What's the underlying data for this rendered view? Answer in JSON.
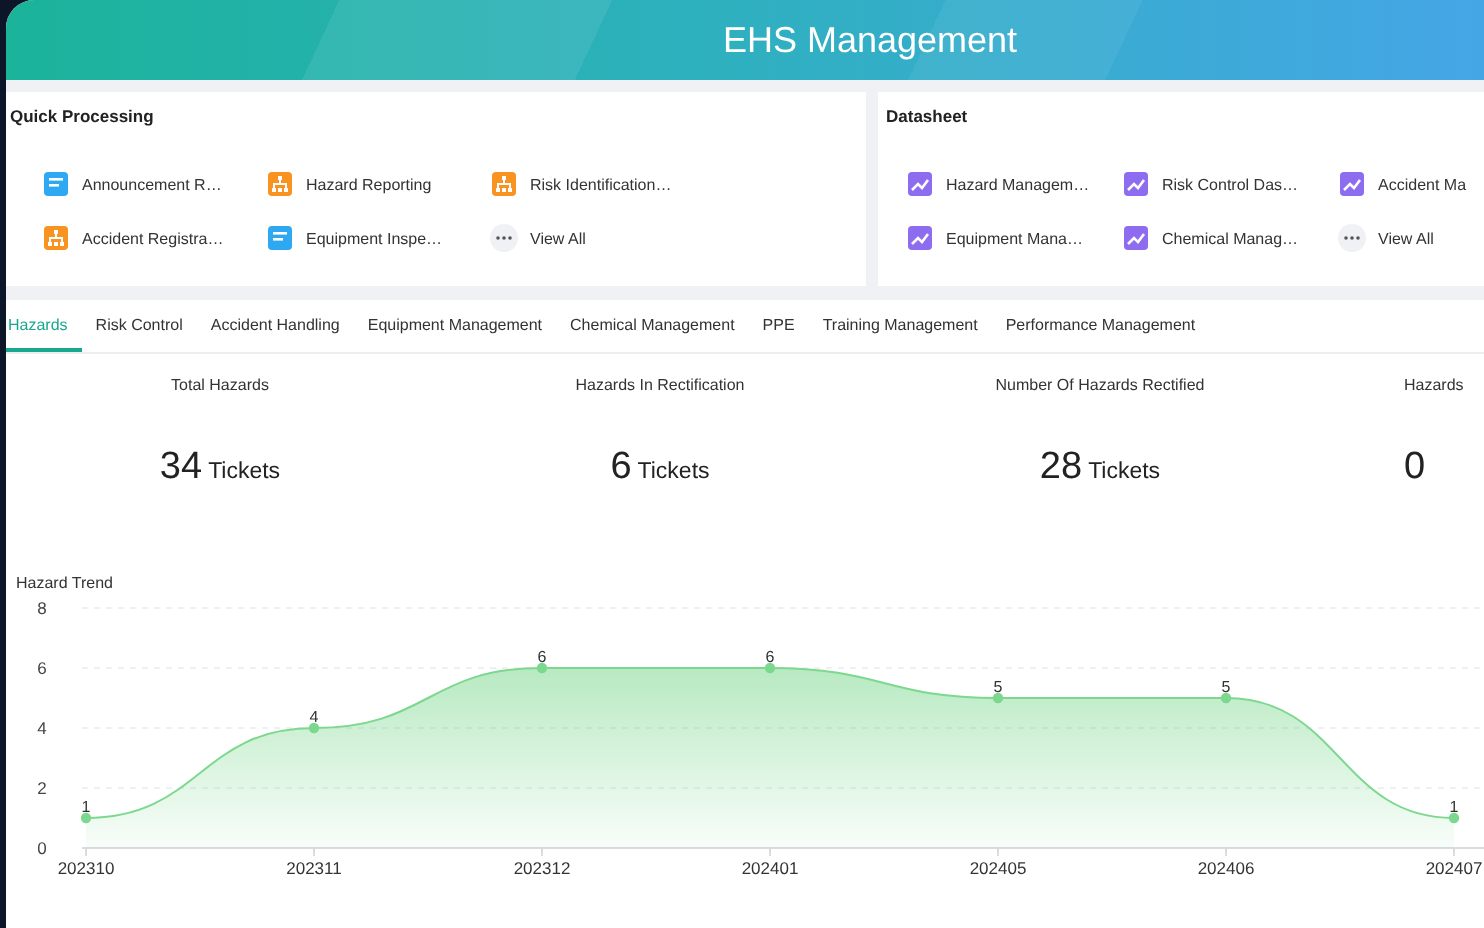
{
  "header": {
    "title": "EHS Management"
  },
  "quick_processing": {
    "title": "Quick Processing",
    "items": [
      {
        "label": "Announcement R…",
        "kind": "doc"
      },
      {
        "label": "Hazard Reporting",
        "kind": "org"
      },
      {
        "label": "Risk Identification…",
        "kind": "org"
      },
      {
        "label": "Accident Registra…",
        "kind": "org"
      },
      {
        "label": "Equipment Inspe…",
        "kind": "doc"
      },
      {
        "label": "View All",
        "kind": "more"
      }
    ]
  },
  "datasheet": {
    "title": "Datasheet",
    "items": [
      {
        "label": "Hazard Managem…",
        "kind": "chart"
      },
      {
        "label": "Risk Control Das…",
        "kind": "chart"
      },
      {
        "label": "Accident Ma",
        "kind": "chart"
      },
      {
        "label": "Equipment Mana…",
        "kind": "chart"
      },
      {
        "label": "Chemical Manag…",
        "kind": "chart"
      },
      {
        "label": "View All",
        "kind": "more"
      }
    ]
  },
  "tabs": [
    {
      "label": "Hazards",
      "selected": true
    },
    {
      "label": "Risk Control",
      "selected": false
    },
    {
      "label": "Accident Handling",
      "selected": false
    },
    {
      "label": "Equipment Management",
      "selected": false
    },
    {
      "label": "Chemical Management",
      "selected": false
    },
    {
      "label": "PPE",
      "selected": false
    },
    {
      "label": "Training Management",
      "selected": false
    },
    {
      "label": "Performance Management",
      "selected": false
    }
  ],
  "stats": [
    {
      "label": "Total Hazards",
      "value": "34",
      "unit": "Tickets"
    },
    {
      "label": "Hazards In Rectification",
      "value": "6",
      "unit": "Tickets"
    },
    {
      "label": "Number Of Hazards Rectified",
      "value": "28",
      "unit": "Tickets"
    },
    {
      "label": "Hazards",
      "value": "0"
    }
  ],
  "trend": {
    "title": "Hazard Trend",
    "chart_data": {
      "type": "area",
      "categories": [
        "202310",
        "202311",
        "202312",
        "202401",
        "202405",
        "202406",
        "202407"
      ],
      "series": [
        {
          "color": "#7dd88f",
          "values": [
            1,
            4,
            6,
            6,
            5,
            5,
            1
          ]
        }
      ],
      "ylim": [
        0,
        8
      ],
      "yticks": [
        0,
        2,
        4,
        6,
        8
      ],
      "grid": true,
      "data_labels": true
    }
  }
}
